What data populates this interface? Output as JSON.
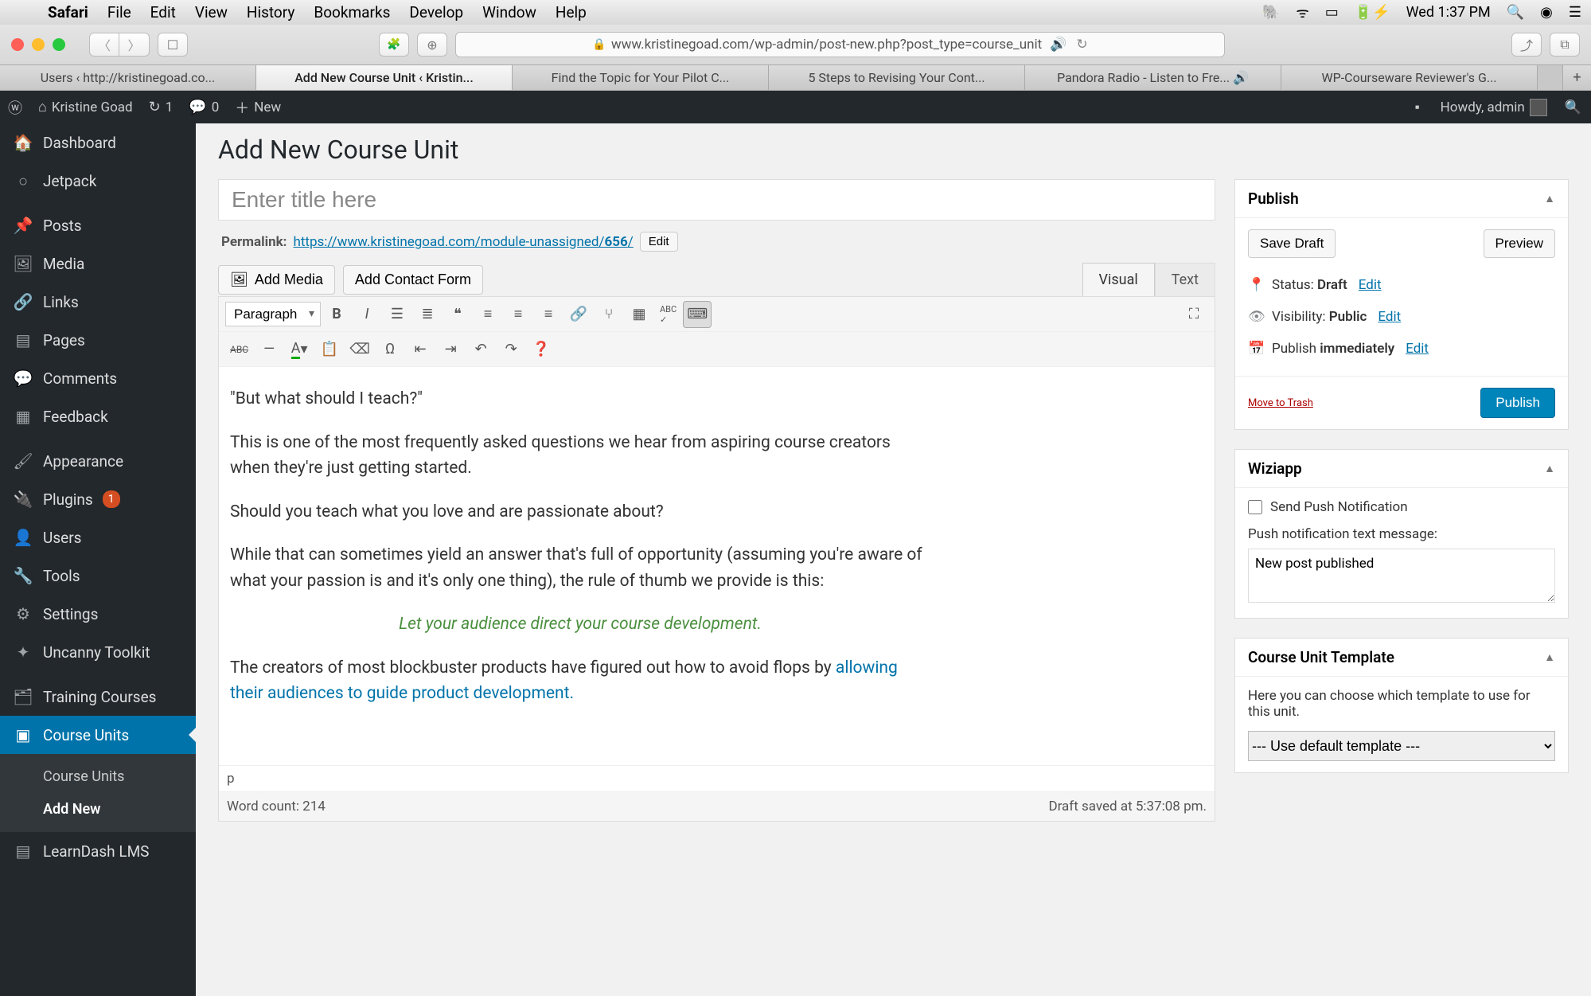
{
  "menubar": {
    "app": "Safari",
    "items": [
      "File",
      "Edit",
      "View",
      "History",
      "Bookmarks",
      "Develop",
      "Window",
      "Help"
    ],
    "time": "Wed 1:37 PM"
  },
  "browser": {
    "url": "www.kristinegoad.com/wp-admin/post-new.php?post_type=course_unit",
    "tabs": [
      "Users ‹ http://kristinegoad.co...",
      "Add New Course Unit ‹ Kristin...",
      "Find the Topic for Your Pilot C...",
      "5 Steps to Revising Your Cont...",
      "Pandora Radio - Listen to Fre...   🔊",
      "WP-Courseware Reviewer's G..."
    ],
    "activeTab": 1
  },
  "adminbar": {
    "site": "Kristine Goad",
    "updates": "1",
    "comments": "0",
    "new": "New",
    "howdy": "Howdy, admin"
  },
  "sidebar": {
    "items": [
      {
        "icon": "🏠",
        "label": "Dashboard"
      },
      {
        "icon": "○",
        "label": "Jetpack"
      },
      {
        "sep": true
      },
      {
        "icon": "📌",
        "label": "Posts"
      },
      {
        "icon": "🖼",
        "label": "Media"
      },
      {
        "icon": "🔗",
        "label": "Links"
      },
      {
        "icon": "▤",
        "label": "Pages"
      },
      {
        "icon": "💬",
        "label": "Comments"
      },
      {
        "icon": "▦",
        "label": "Feedback"
      },
      {
        "sep": true
      },
      {
        "icon": "🖌",
        "label": "Appearance"
      },
      {
        "icon": "🔌",
        "label": "Plugins",
        "badge": "1"
      },
      {
        "icon": "👤",
        "label": "Users"
      },
      {
        "icon": "🔧",
        "label": "Tools"
      },
      {
        "icon": "⚙",
        "label": "Settings"
      },
      {
        "icon": "✦",
        "label": "Uncanny Toolkit"
      },
      {
        "sep": true
      },
      {
        "icon": "🗂",
        "label": "Training Courses"
      },
      {
        "icon": "▣",
        "label": "Course Units",
        "current": true
      },
      {
        "icon": "▤",
        "label": "LearnDash LMS"
      }
    ],
    "submenu": {
      "items": [
        "Course Units",
        "Add New"
      ],
      "active": 1
    }
  },
  "page": {
    "title": "Add New Course Unit",
    "title_placeholder": "Enter title here",
    "permalink_label": "Permalink:",
    "permalink_base": "https://www.kristinegoad.com/module-unassigned/",
    "permalink_id": "656",
    "permalink_edit": "Edit",
    "add_media": "Add Media",
    "add_contact": "Add Contact Form",
    "tab_visual": "Visual",
    "tab_text": "Text",
    "format_select": "Paragraph",
    "body": {
      "p1": "\"But what should I teach?\"",
      "p2": "This is one of the most frequently asked questions we hear from aspiring course creators when they're just getting started.",
      "p3": "Should you teach what you love and are passionate about?",
      "p4": "While that can sometimes yield an answer that's full of opportunity (assuming you're aware of what your passion is and it's only one thing), the rule of thumb we provide is this:",
      "callout": "Let your audience direct your course development.",
      "p5_pre": "The creators of most blockbuster products have figured out how to avoid flops by ",
      "p5_link": "allowing their audiences to guide product development."
    },
    "path": "p",
    "word_count": "Word count: 214",
    "draft_saved": "Draft saved at 5:37:08 pm."
  },
  "publish": {
    "heading": "Publish",
    "save_draft": "Save Draft",
    "preview": "Preview",
    "status_label": "Status:",
    "status_value": "Draft",
    "visibility_label": "Visibility:",
    "visibility_value": "Public",
    "schedule_label": "Publish",
    "schedule_value": "immediately",
    "edit": "Edit",
    "trash": "Move to Trash",
    "publish_btn": "Publish"
  },
  "wiziapp": {
    "heading": "Wiziapp",
    "checkbox": "Send Push Notification",
    "msg_label": "Push notification text message:",
    "msg_value": "New post published"
  },
  "template": {
    "heading": "Course Unit Template",
    "desc": "Here you can choose which template to use for this unit.",
    "select": "--- Use default template ---"
  }
}
